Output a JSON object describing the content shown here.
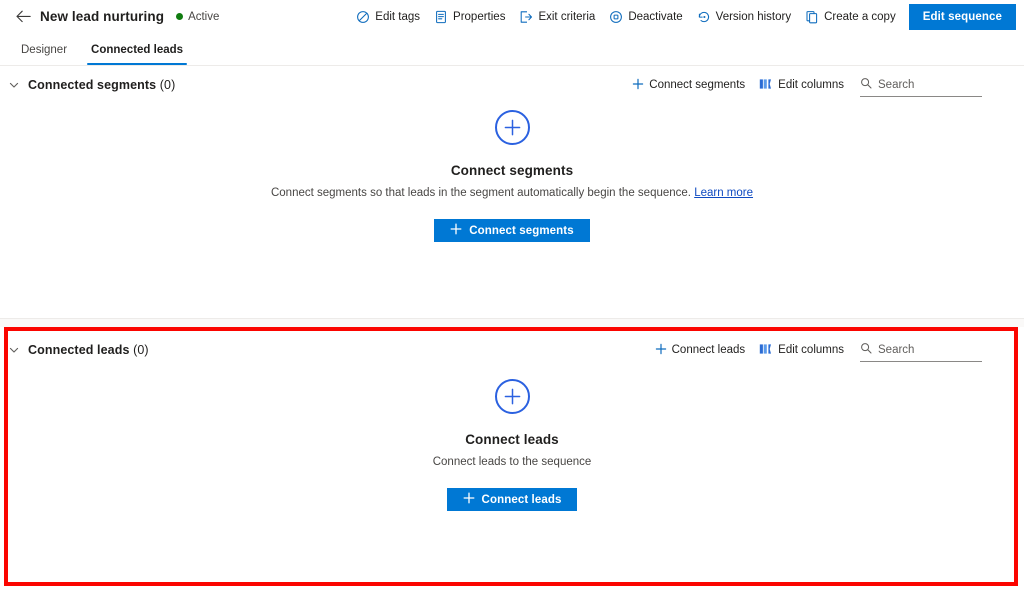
{
  "header": {
    "back_icon": "back-arrow-icon",
    "title": "New lead nurturing",
    "status": "Active",
    "status_color": "#107c10",
    "commands": [
      {
        "icon": "tag-icon",
        "label": "Edit tags"
      },
      {
        "icon": "document-icon",
        "label": "Properties"
      },
      {
        "icon": "exit-icon",
        "label": "Exit criteria"
      },
      {
        "icon": "deactivate-icon",
        "label": "Deactivate"
      },
      {
        "icon": "history-icon",
        "label": "Version history"
      },
      {
        "icon": "copy-icon",
        "label": "Create a copy"
      }
    ],
    "primary_button": "Edit sequence",
    "accent_color": "#0078d4"
  },
  "tabs": [
    {
      "label": "Designer",
      "active": false
    },
    {
      "label": "Connected leads",
      "active": true
    }
  ],
  "segments_section": {
    "chevron_icon": "chevron-down-icon",
    "title": "Connected segments",
    "count": "(0)",
    "actions": [
      {
        "icon": "plus-icon",
        "label": "Connect segments"
      },
      {
        "icon": "columns-icon",
        "label": "Edit columns"
      }
    ],
    "search_placeholder": "Search",
    "search_value": "",
    "search_icon": "search-icon",
    "empty": {
      "icon": "plus-circle-icon",
      "title": "Connect segments",
      "description": "Connect segments so that leads in the segment automatically begin the sequence.",
      "link_text": "Learn more",
      "cta_label": "Connect segments"
    }
  },
  "leads_section": {
    "chevron_icon": "chevron-down-icon",
    "title": "Connected leads",
    "count": "(0)",
    "actions": [
      {
        "icon": "plus-icon",
        "label": "Connect leads"
      },
      {
        "icon": "columns-icon",
        "label": "Edit columns"
      }
    ],
    "search_placeholder": "Search",
    "search_value": "",
    "search_icon": "search-icon",
    "empty": {
      "icon": "plus-circle-icon",
      "title": "Connect leads",
      "description": "Connect leads to the sequence",
      "cta_label": "Connect leads"
    },
    "highlight_color": "#fb0500"
  }
}
